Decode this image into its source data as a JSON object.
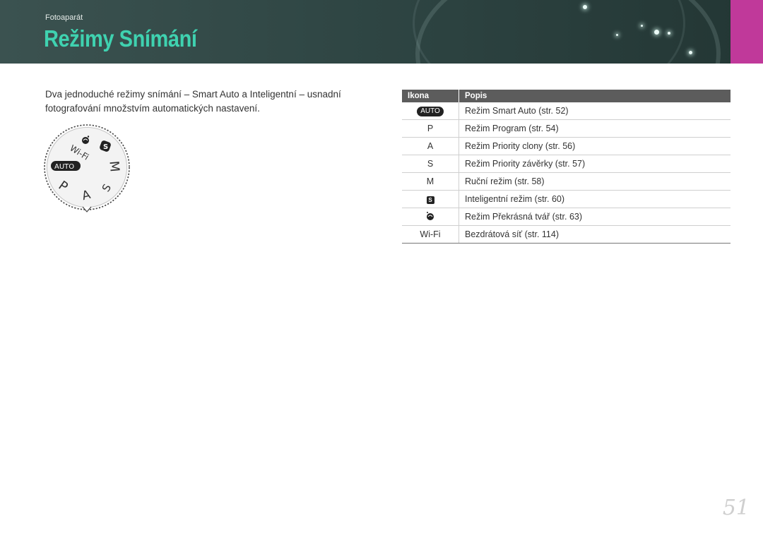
{
  "header": {
    "section_label": "Fotoaparát",
    "title": "Režimy Snímání",
    "accent_color": "#c0399a",
    "title_color": "#3fd2b0"
  },
  "intro": {
    "text": "Dva jednoduché režimy snímání – Smart Auto a Inteligentní – usnadní fotografování množstvím automatických nastavení."
  },
  "dial": {
    "auto_label": "AUTO",
    "modes": [
      "Wi-Fi",
      "P",
      "A",
      "S",
      "M"
    ],
    "icons": [
      "beauty-face-icon",
      "smart-mode-icon"
    ]
  },
  "table": {
    "headers": {
      "icon": "Ikona",
      "description": "Popis"
    },
    "rows": [
      {
        "icon": "AUTO",
        "icon_type": "auto-badge",
        "description": "Režim Smart Auto (str. 52)"
      },
      {
        "icon": "P",
        "icon_type": "text",
        "description": "Režim Program (str. 54)"
      },
      {
        "icon": "A",
        "icon_type": "text",
        "description": "Režim Priority clony (str. 56)"
      },
      {
        "icon": "S",
        "icon_type": "text",
        "description": "Režim Priority závěrky (str. 57)"
      },
      {
        "icon": "M",
        "icon_type": "text",
        "description": "Ruční režim (str. 58)"
      },
      {
        "icon": "smart-mode-icon",
        "icon_type": "glyph",
        "description": "Inteligentní režim (str. 60)"
      },
      {
        "icon": "beauty-face-icon",
        "icon_type": "glyph",
        "description": "Režim Překrásná tvář (str. 63)"
      },
      {
        "icon": "Wi-Fi",
        "icon_type": "text",
        "description": "Bezdrátová síť (str. 114)"
      }
    ]
  },
  "page_number": "51"
}
